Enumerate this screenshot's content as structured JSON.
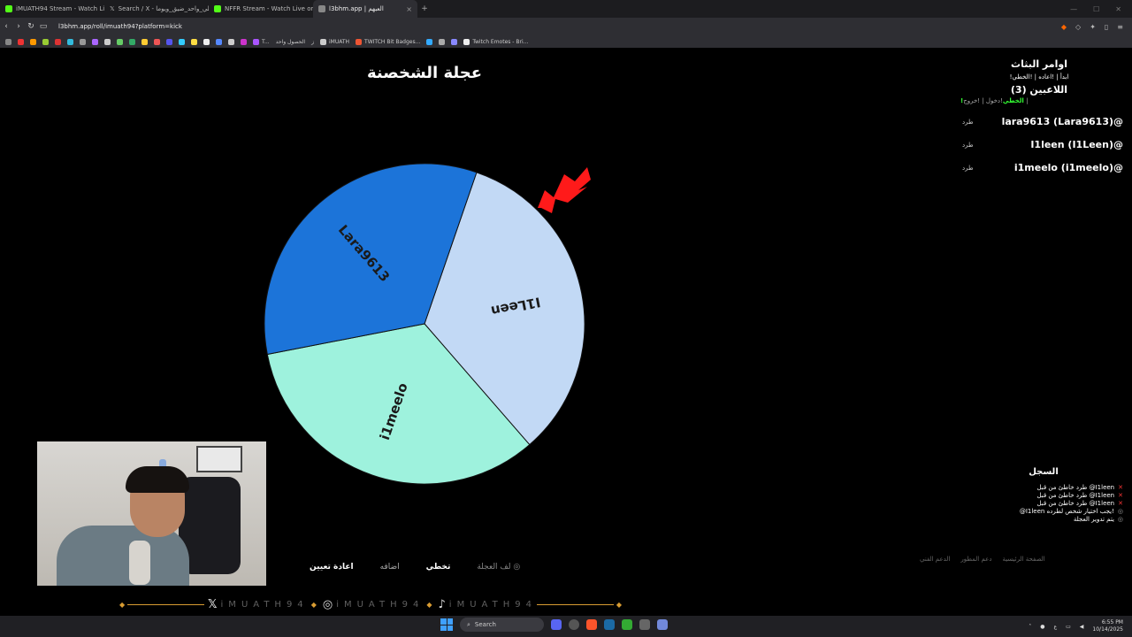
{
  "browser": {
    "tabs": [
      {
        "label": "iMUATH94 Stream - Watch Live o",
        "color": "#53fc18"
      },
      {
        "label": "Search / X - ‏#العلي_واحد_ضيق_ويوما",
        "color": "#ffffff"
      },
      {
        "label": "NFFR Stream - Watch Live on Kick",
        "color": "#53fc18"
      },
      {
        "label": "l3bhm.app | العبهم",
        "color": "#ffffff",
        "active": true
      }
    ],
    "new_tab": "+",
    "url": "l3bhm.app/roll/imuath94?platform=kick",
    "bookmarks": [
      "T...",
      "الحصول واحد",
      "ز",
      "iMUATH",
      "TWITCH Bit Badges...",
      "Twitch Emotes - Bri..."
    ]
  },
  "page": {
    "title": "عجلة الشخصنة"
  },
  "wheel": {
    "segments": [
      {
        "label": "I1Leen",
        "color": "#c2d9f5",
        "text_color": "#1a1a1a"
      },
      {
        "label": "i1meelo",
        "color": "#9ef2dd",
        "text_color": "#1a1a1a"
      },
      {
        "label": "Lara9613",
        "color": "#1c74d9",
        "text_color": "#1a1a1a"
      }
    ],
    "pointer_color": "#ff1a1a"
  },
  "sidebar": {
    "title": "اوامر البثاث",
    "commands": "!ابدأ | !اعاده | !الخطي",
    "players_heading": "اللاعبين (3)",
    "join_prefix": "!دخول | !خروج |",
    "join_highlight": "!الخطي",
    "kick_label": "طرد",
    "players": [
      "lara9613 (Lara9613)@",
      "I1leen (I1Leen)@",
      "i1meelo (i1meelo)@"
    ]
  },
  "log": {
    "title": "السجل",
    "entries": [
      {
        "mark": "✕",
        "text": "طرد خاطئ من قبل @I1leen",
        "type": "error"
      },
      {
        "mark": "✕",
        "text": "طرد خاطئ من قبل @I1leen",
        "type": "error"
      },
      {
        "mark": "✕",
        "text": "طرد خاطئ من قبل @I1leen",
        "type": "error"
      },
      {
        "mark": "◎",
        "text": "@I1leen يجب اختيار شخص لطرده!",
        "type": "info"
      },
      {
        "mark": "◎",
        "text": "يتم تدوير العجلة",
        "type": "info"
      }
    ]
  },
  "footer_links": [
    "الصفحة الرئيسية",
    "دعم المطور",
    "الدعم الفني"
  ],
  "controls": {
    "spin": "لف العجلة",
    "skip": "تخطي",
    "add": "اضافه",
    "reset": "اعادة تعيين"
  },
  "overlay": {
    "handle": "iMUATH94"
  },
  "taskbar": {
    "search_placeholder": "Search",
    "time": "6:55 PM",
    "date": "10/14/2025"
  }
}
